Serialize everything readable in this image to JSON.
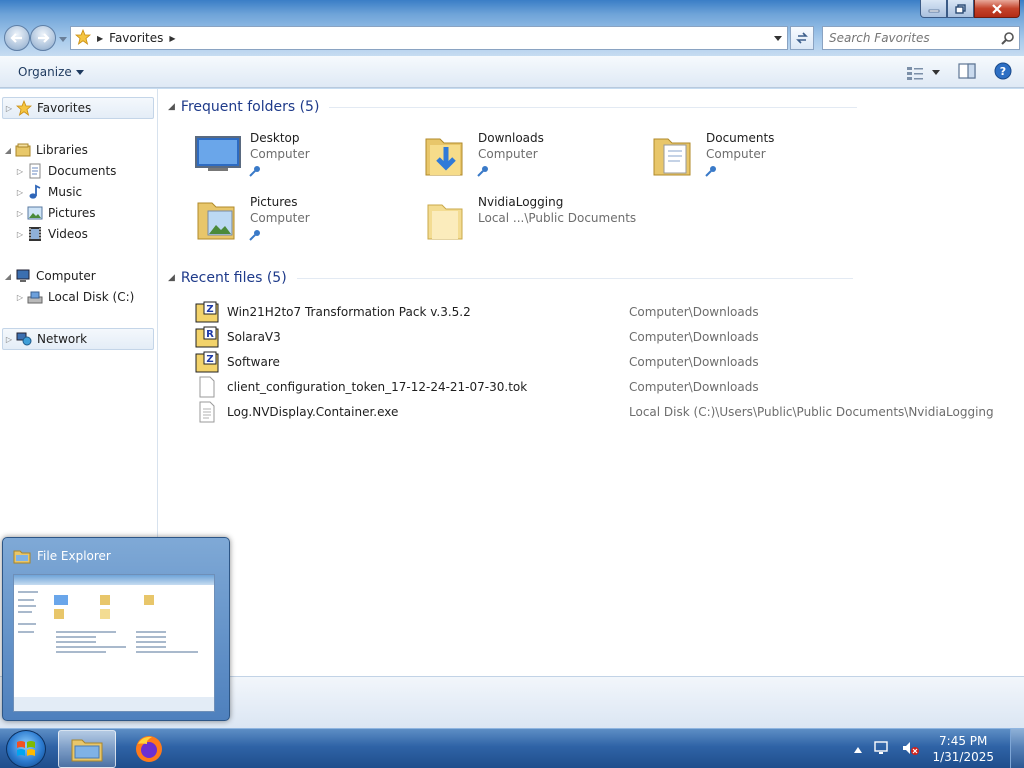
{
  "window": {
    "address": {
      "star": "star-icon",
      "location": "Favorites"
    },
    "search": {
      "placeholder": "Search Favorites"
    },
    "toolbar": {
      "organize": "Organize"
    }
  },
  "nav": {
    "favorites": "Favorites",
    "libraries": "Libraries",
    "documents": "Documents",
    "music": "Music",
    "pictures": "Pictures",
    "videos": "Videos",
    "computer": "Computer",
    "local_disk": "Local Disk (C:)",
    "network": "Network"
  },
  "frequent": {
    "header": "Frequent folders (5)",
    "items": [
      {
        "name": "Desktop",
        "sub": "Computer",
        "pinned": true
      },
      {
        "name": "Downloads",
        "sub": "Computer",
        "pinned": true
      },
      {
        "name": "Documents",
        "sub": "Computer",
        "pinned": true
      },
      {
        "name": "Pictures",
        "sub": "Computer",
        "pinned": true
      },
      {
        "name": "NvidiaLogging",
        "sub": "Local ...\\Public Documents",
        "pinned": false
      }
    ]
  },
  "recent": {
    "header": "Recent files (5)",
    "items": [
      {
        "name": "Win21H2to7 Transformation Pack v.3.5.2",
        "path": "Computer\\Downloads",
        "icon": "archive-z-icon",
        "badge": "Z"
      },
      {
        "name": "SolaraV3",
        "path": "Computer\\Downloads",
        "icon": "archive-r-icon",
        "badge": "R"
      },
      {
        "name": "Software",
        "path": "Computer\\Downloads",
        "icon": "archive-z-icon",
        "badge": "Z"
      },
      {
        "name": "client_configuration_token_17-12-24-21-07-30.tok",
        "path": "Computer\\Downloads",
        "icon": "blank-file-icon"
      },
      {
        "name": "Log.NVDisplay.Container.exe",
        "path": "Local Disk (C:)\\Users\\Public\\Public Documents\\NvidiaLogging",
        "icon": "text-file-icon"
      }
    ]
  },
  "thumbnail": {
    "title": "File Explorer"
  },
  "taskbar": {
    "time": "7:45 PM",
    "date": "1/31/2025"
  }
}
